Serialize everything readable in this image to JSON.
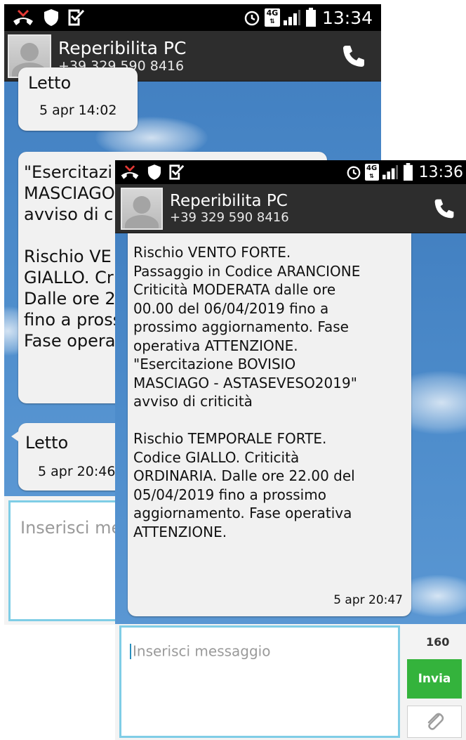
{
  "back_screen": {
    "status": {
      "time": "13:34",
      "network": "4G"
    },
    "header": {
      "contact_name": "Reperibilita PC",
      "contact_number": "+39 329 590 8416"
    },
    "messages": [
      {
        "text": "Letto",
        "time": "5 apr 14:02"
      },
      {
        "text": "\"Esercitazi\nMASCIAGO\navviso di c\n\nRischio VE\nGIALLO. Cr\nDalle ore 2\nfino a pross\nFase opera",
        "time": ""
      },
      {
        "text": "Letto",
        "time": "5 apr 20:46"
      }
    ],
    "input_placeholder": "Inserisci me"
  },
  "front_screen": {
    "status": {
      "time": "13:36",
      "network": "4G"
    },
    "header": {
      "contact_name": "Reperibilita PC",
      "contact_number": "+39 329 590 8416"
    },
    "message": {
      "text": "Rischio VENTO FORTE.\nPassaggio in Codice ARANCIONE\nCriticità MODERATA dalle ore\n00.00 del 06/04/2019 fino a\nprossimo aggiornamento. Fase\noperativa ATTENZIONE.\n\"Esercitazione BOVISIO\nMASCIAGO - ASTASEVESO2019\"\navviso di criticità\n\nRischio TEMPORALE FORTE.\nCodice GIALLO. Criticità\nORDINARIA. Dalle ore 22.00 del\n05/04/2019 fino a prossimo\naggiornamento. Fase operativa\nATTENZIONE.",
      "time": "5 apr 20:47"
    },
    "input_placeholder": "Inserisci messaggio",
    "char_count": "160",
    "send_label": "Invia"
  },
  "icons": [
    "missed-call-icon",
    "shield-icon",
    "checkbox-icon",
    "alarm-icon",
    "network-4g-icon",
    "signal-icon",
    "battery-icon",
    "phone-icon",
    "avatar-placeholder-icon",
    "paperclip-icon"
  ],
  "colors": {
    "accent_send": "#34b33c",
    "input_border": "#7fcde6",
    "header_bg": "#2d2d2d",
    "chat_bg": "#4a88c8"
  }
}
